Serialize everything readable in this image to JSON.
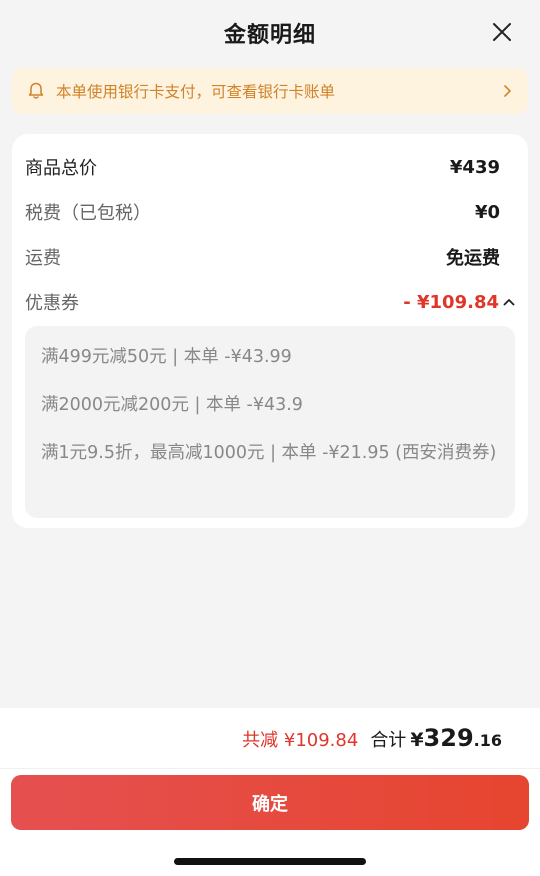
{
  "header": {
    "title": "金额明细"
  },
  "notice": {
    "text": "本单使用银行卡支付，可查看银行卡账单"
  },
  "details": {
    "rows": [
      {
        "label": "商品总价",
        "value": "¥439"
      },
      {
        "label": "税费（已包税）",
        "value": "¥0"
      },
      {
        "label": "运费",
        "value": "免运费"
      }
    ],
    "coupon": {
      "label": "优惠券",
      "value": "- ¥109.84",
      "items": [
        "满499元减50元 | 本单 -¥43.99",
        "满2000元减200元 | 本单 -¥43.9",
        "满1元9.5折，最高减1000元 | 本单 -¥21.95 (西安消费券)"
      ]
    }
  },
  "summary": {
    "saved": "共减 ¥109.84",
    "total_label": "合计",
    "total_currency": "¥",
    "total_int": "329",
    "total_dec": ".16"
  },
  "confirm_label": "确定",
  "colors": {
    "accent": "#e0352b",
    "notice_text": "#d1832a",
    "notice_bg": "#fdf3df"
  },
  "icons": {
    "close": "close-icon",
    "bell": "bell-icon",
    "notice_chevron": "chevron-right-icon",
    "collapse": "chevron-up-icon"
  }
}
